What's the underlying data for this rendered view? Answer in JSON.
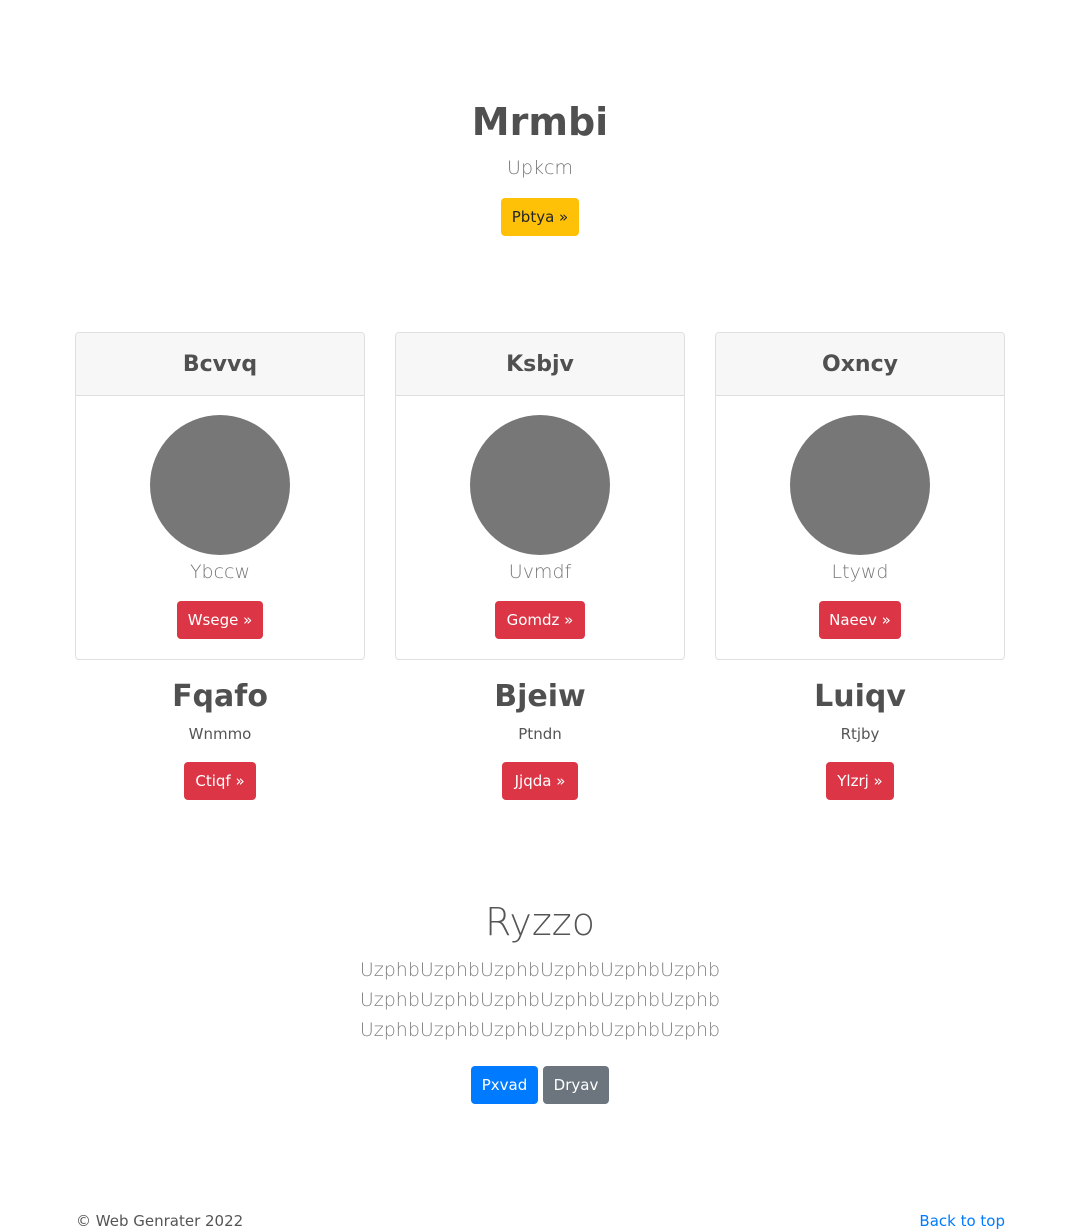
{
  "hero": {
    "title": "Mrmbi",
    "subtitle": "Upkcm",
    "button": "Pbtya »"
  },
  "cards": [
    {
      "header": "Bcvvq",
      "text": "Ybccw",
      "button": "Wsege »"
    },
    {
      "header": "Ksbjv",
      "text": "Uvmdf",
      "button": "Gomdz »"
    },
    {
      "header": "Oxncy",
      "text": "Ltywd",
      "button": "Naeev »"
    }
  ],
  "columns": [
    {
      "title": "Fqafo",
      "subtitle": "Wnmmo",
      "button": "Ctiqf »"
    },
    {
      "title": "Bjeiw",
      "subtitle": "Ptndn",
      "button": "Jjqda »"
    },
    {
      "title": "Luiqv",
      "subtitle": "Rtjby",
      "button": "Ylzrj »"
    }
  ],
  "section": {
    "title": "Ryzzo",
    "lines": [
      "UzphbUzphbUzphbUzphbUzphbUzphb",
      "UzphbUzphbUzphbUzphbUzphbUzphb",
      "UzphbUzphbUzphbUzphbUzphbUzphb"
    ],
    "primary_button": "Pxvad",
    "secondary_button": "Dryav"
  },
  "footer": {
    "copyright": "© Web Genrater 2022",
    "back_to_top": "Back to top"
  }
}
